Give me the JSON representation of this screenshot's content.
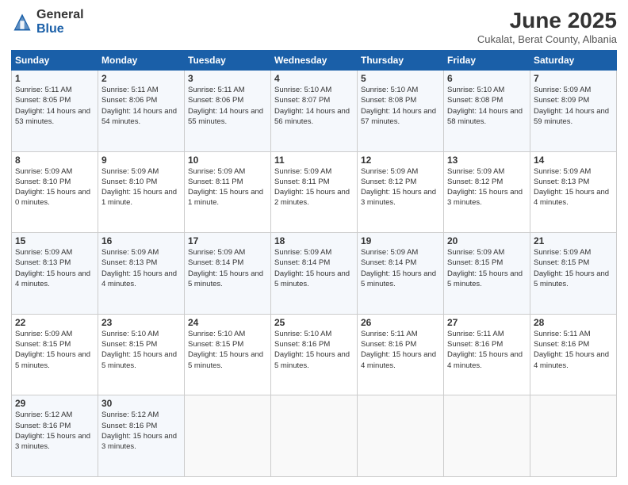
{
  "header": {
    "logo_general": "General",
    "logo_blue": "Blue",
    "month": "June 2025",
    "location": "Cukalat, Berat County, Albania"
  },
  "weekdays": [
    "Sunday",
    "Monday",
    "Tuesday",
    "Wednesday",
    "Thursday",
    "Friday",
    "Saturday"
  ],
  "weeks": [
    [
      {
        "day": "1",
        "sunrise": "5:11 AM",
        "sunset": "8:05 PM",
        "daylight": "14 hours and 53 minutes."
      },
      {
        "day": "2",
        "sunrise": "5:11 AM",
        "sunset": "8:06 PM",
        "daylight": "14 hours and 54 minutes."
      },
      {
        "day": "3",
        "sunrise": "5:11 AM",
        "sunset": "8:06 PM",
        "daylight": "14 hours and 55 minutes."
      },
      {
        "day": "4",
        "sunrise": "5:10 AM",
        "sunset": "8:07 PM",
        "daylight": "14 hours and 56 minutes."
      },
      {
        "day": "5",
        "sunrise": "5:10 AM",
        "sunset": "8:08 PM",
        "daylight": "14 hours and 57 minutes."
      },
      {
        "day": "6",
        "sunrise": "5:10 AM",
        "sunset": "8:08 PM",
        "daylight": "14 hours and 58 minutes."
      },
      {
        "day": "7",
        "sunrise": "5:09 AM",
        "sunset": "8:09 PM",
        "daylight": "14 hours and 59 minutes."
      }
    ],
    [
      {
        "day": "8",
        "sunrise": "5:09 AM",
        "sunset": "8:10 PM",
        "daylight": "15 hours and 0 minutes."
      },
      {
        "day": "9",
        "sunrise": "5:09 AM",
        "sunset": "8:10 PM",
        "daylight": "15 hours and 1 minute."
      },
      {
        "day": "10",
        "sunrise": "5:09 AM",
        "sunset": "8:11 PM",
        "daylight": "15 hours and 1 minute."
      },
      {
        "day": "11",
        "sunrise": "5:09 AM",
        "sunset": "8:11 PM",
        "daylight": "15 hours and 2 minutes."
      },
      {
        "day": "12",
        "sunrise": "5:09 AM",
        "sunset": "8:12 PM",
        "daylight": "15 hours and 3 minutes."
      },
      {
        "day": "13",
        "sunrise": "5:09 AM",
        "sunset": "8:12 PM",
        "daylight": "15 hours and 3 minutes."
      },
      {
        "day": "14",
        "sunrise": "5:09 AM",
        "sunset": "8:13 PM",
        "daylight": "15 hours and 4 minutes."
      }
    ],
    [
      {
        "day": "15",
        "sunrise": "5:09 AM",
        "sunset": "8:13 PM",
        "daylight": "15 hours and 4 minutes."
      },
      {
        "day": "16",
        "sunrise": "5:09 AM",
        "sunset": "8:13 PM",
        "daylight": "15 hours and 4 minutes."
      },
      {
        "day": "17",
        "sunrise": "5:09 AM",
        "sunset": "8:14 PM",
        "daylight": "15 hours and 5 minutes."
      },
      {
        "day": "18",
        "sunrise": "5:09 AM",
        "sunset": "8:14 PM",
        "daylight": "15 hours and 5 minutes."
      },
      {
        "day": "19",
        "sunrise": "5:09 AM",
        "sunset": "8:14 PM",
        "daylight": "15 hours and 5 minutes."
      },
      {
        "day": "20",
        "sunrise": "5:09 AM",
        "sunset": "8:15 PM",
        "daylight": "15 hours and 5 minutes."
      },
      {
        "day": "21",
        "sunrise": "5:09 AM",
        "sunset": "8:15 PM",
        "daylight": "15 hours and 5 minutes."
      }
    ],
    [
      {
        "day": "22",
        "sunrise": "5:09 AM",
        "sunset": "8:15 PM",
        "daylight": "15 hours and 5 minutes."
      },
      {
        "day": "23",
        "sunrise": "5:10 AM",
        "sunset": "8:15 PM",
        "daylight": "15 hours and 5 minutes."
      },
      {
        "day": "24",
        "sunrise": "5:10 AM",
        "sunset": "8:15 PM",
        "daylight": "15 hours and 5 minutes."
      },
      {
        "day": "25",
        "sunrise": "5:10 AM",
        "sunset": "8:16 PM",
        "daylight": "15 hours and 5 minutes."
      },
      {
        "day": "26",
        "sunrise": "5:11 AM",
        "sunset": "8:16 PM",
        "daylight": "15 hours and 4 minutes."
      },
      {
        "day": "27",
        "sunrise": "5:11 AM",
        "sunset": "8:16 PM",
        "daylight": "15 hours and 4 minutes."
      },
      {
        "day": "28",
        "sunrise": "5:11 AM",
        "sunset": "8:16 PM",
        "daylight": "15 hours and 4 minutes."
      }
    ],
    [
      {
        "day": "29",
        "sunrise": "5:12 AM",
        "sunset": "8:16 PM",
        "daylight": "15 hours and 3 minutes."
      },
      {
        "day": "30",
        "sunrise": "5:12 AM",
        "sunset": "8:16 PM",
        "daylight": "15 hours and 3 minutes."
      },
      null,
      null,
      null,
      null,
      null
    ]
  ]
}
